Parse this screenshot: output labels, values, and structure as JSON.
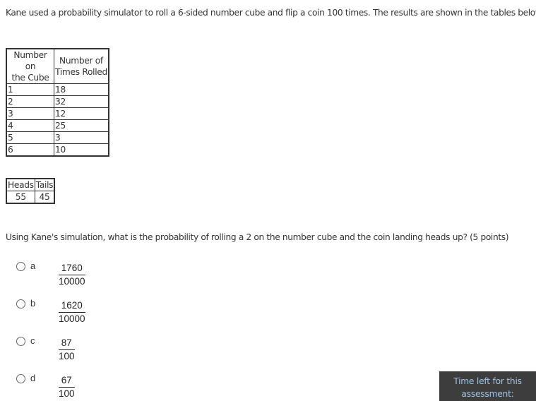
{
  "intro_text": "Kane used a probability simulator to roll a 6-sided number cube and flip a coin 100 times. The results are shown in the tables below:",
  "cube_table": {
    "headers": [
      "Number on the Cube",
      "Number of Times Rolled"
    ],
    "header_lines": [
      [
        "Number on",
        "the Cube"
      ],
      [
        "Number of",
        "Times Rolled"
      ]
    ],
    "rows": [
      [
        "1",
        "18"
      ],
      [
        "2",
        "32"
      ],
      [
        "3",
        "12"
      ],
      [
        "4",
        "25"
      ],
      [
        "5",
        "3"
      ],
      [
        "6",
        "10"
      ]
    ]
  },
  "coin_table": {
    "headers": [
      "Heads",
      "Tails"
    ],
    "values": [
      "55",
      "45"
    ]
  },
  "question": "Using Kane's simulation, what is the probability of rolling a 2 on the number cube and the coin landing heads up? (5 points)",
  "options": [
    {
      "letter": "a",
      "numerator": "1760",
      "denominator": "10000"
    },
    {
      "letter": "b",
      "numerator": "1620",
      "denominator": "10000"
    },
    {
      "letter": "c",
      "numerator": "87",
      "denominator": "100"
    },
    {
      "letter": "d",
      "numerator": "67",
      "denominator": "100"
    }
  ],
  "timer": {
    "line1": "Time left for this",
    "line2": "assessment:"
  },
  "colors": {
    "timer_bg": "#3d3d3d",
    "timer_text": "#9ec4e4"
  }
}
